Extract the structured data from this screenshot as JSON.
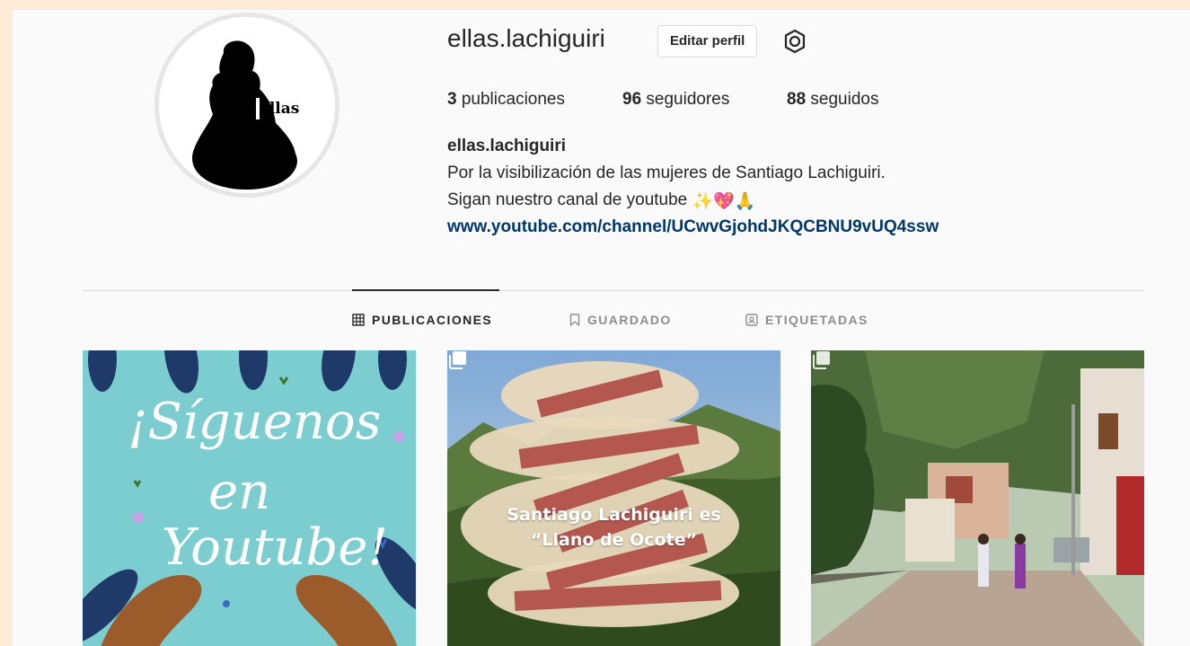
{
  "profile": {
    "username": "ellas.lachiguiri",
    "avatar_text": "ellas",
    "edit_button_label": "Editar perfil",
    "settings_icon": "gear-icon"
  },
  "stats": {
    "posts_count": "3",
    "posts_label": " publicaciones",
    "followers_count": "96",
    "followers_label": " seguidores",
    "following_count": "88",
    "following_label": " seguidos"
  },
  "bio": {
    "name": "ellas.lachiguiri",
    "line1": "Por la visibilización de las mujeres de Santiago Lachiguiri.",
    "line2": "Sigan nuestro canal de youtube ",
    "emojis": "✨💖🙏",
    "link": "www.youtube.com/channel/UCwvGjohdJKQCBNU9vUQ4ssw"
  },
  "tabs": [
    {
      "label": "PUBLICACIONES",
      "icon": "grid-icon",
      "active": true
    },
    {
      "label": "GUARDADO",
      "icon": "bookmark-icon",
      "active": false
    },
    {
      "label": "ETIQUETADAS",
      "icon": "tagged-icon",
      "active": false
    }
  ],
  "posts": [
    {
      "text_lines": [
        "¡Síguenos",
        "en",
        "Youtube!"
      ],
      "bg": "#7ccdd0",
      "multi": false
    },
    {
      "text_lines": [
        "Santiago Lachiguiri es",
        "“Llano de Ocote”"
      ],
      "bg": "#4e6b3a",
      "multi": true
    },
    {
      "text_lines": [],
      "bg": "#8a9a6a",
      "multi": true
    }
  ],
  "colors": {
    "link": "#00376b",
    "text": "#262626",
    "muted": "#8e8e8e",
    "outer_bg": "#fdebd6",
    "page_bg": "#fafafa"
  }
}
